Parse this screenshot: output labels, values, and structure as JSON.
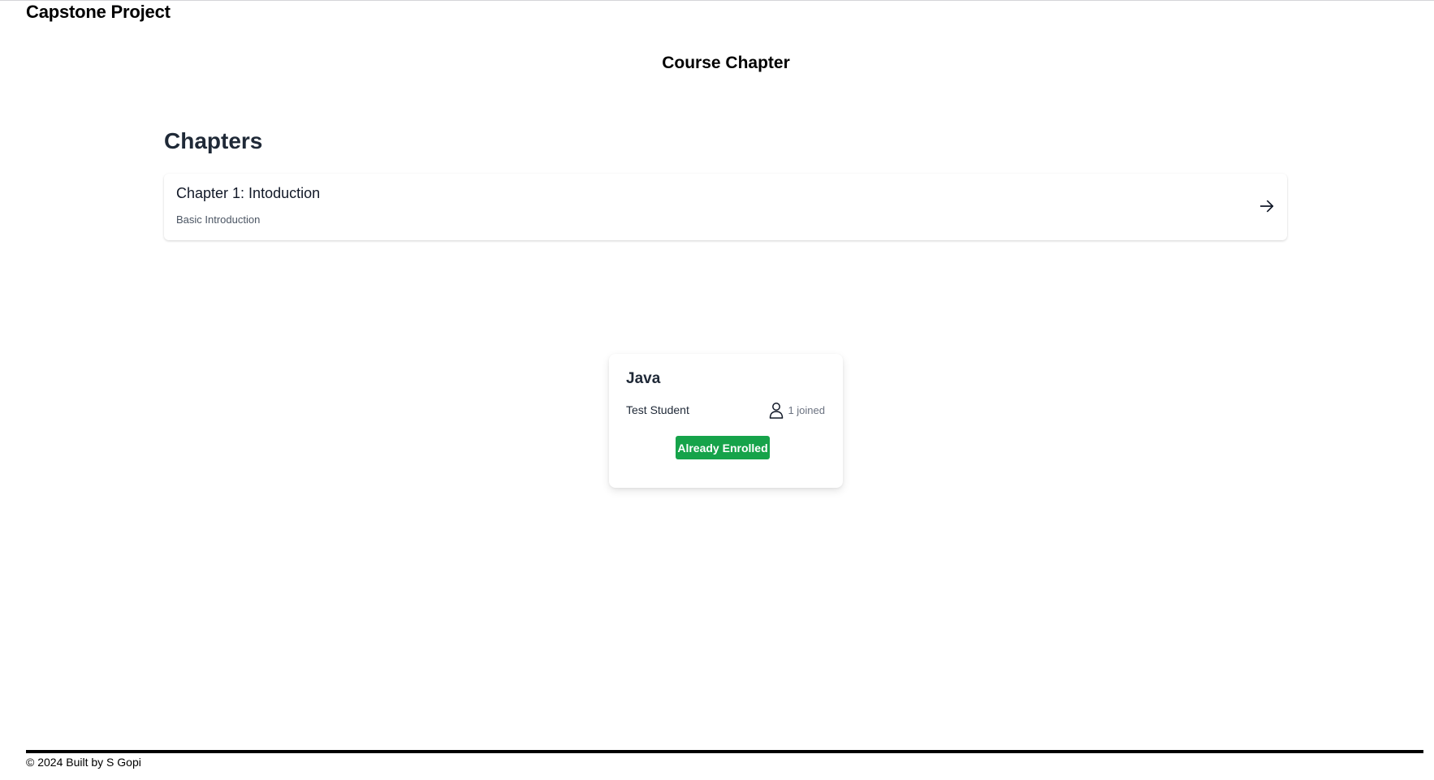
{
  "app": {
    "title": "Capstone Project"
  },
  "page": {
    "heading": "Course Chapter"
  },
  "chapters": {
    "heading": "Chapters",
    "items": [
      {
        "title": "Chapter 1: Intoduction",
        "description": "Basic Introduction",
        "icon": "arrow-right-icon"
      }
    ]
  },
  "course": {
    "title": "Java",
    "author": "Test Student",
    "joined_icon": "user-icon",
    "joined": "1 joined",
    "status": "Already Enrolled"
  },
  "footer": {
    "text": "© 2024 Built by S Gopi"
  },
  "colors": {
    "accent_green": "#16a34a",
    "heading_dark": "#1f2937"
  }
}
